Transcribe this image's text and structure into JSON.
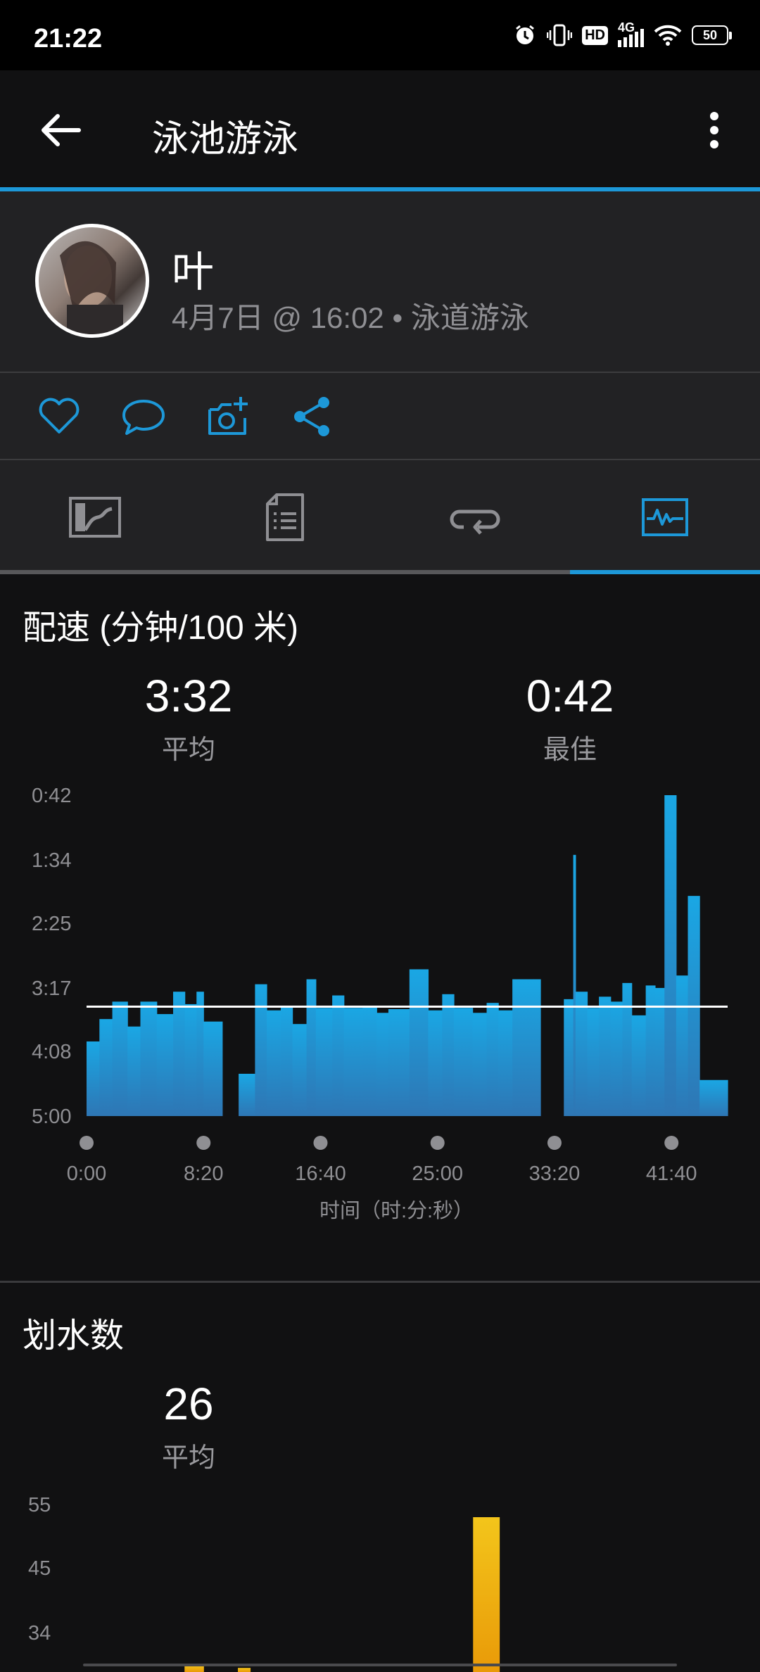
{
  "status": {
    "time": "21:22",
    "hd": "HD",
    "net": "4G",
    "battery": "50"
  },
  "appbar": {
    "title": "泳池游泳",
    "back_icon": "arrow-left-icon",
    "more_icon": "more-vert-icon"
  },
  "header": {
    "name": "叶",
    "meta": "4月7日 @ 16:02 • 泳道游泳"
  },
  "actions": [
    {
      "icon": "heart-icon"
    },
    {
      "icon": "comment-icon"
    },
    {
      "icon": "add-photo-icon"
    },
    {
      "icon": "share-icon"
    }
  ],
  "tabs": [
    {
      "icon": "map-icon",
      "active": false
    },
    {
      "icon": "details-icon",
      "active": false
    },
    {
      "icon": "laps-icon",
      "active": false
    },
    {
      "icon": "charts-icon",
      "active": true
    }
  ],
  "colors": {
    "accent": "#1d98d8",
    "pace_bar": "#2b8fcb",
    "stroke_bar": "#f0a70a",
    "background": "#111112"
  },
  "pace": {
    "title": "配速 (分钟/100 米)",
    "avg_value": "3:32",
    "avg_label": "平均",
    "best_value": "0:42",
    "best_label": "最佳",
    "xlabel": "时间（时:分:秒）"
  },
  "strokes": {
    "title": "划水数",
    "avg_value": "26",
    "avg_label": "平均"
  },
  "chart_data": [
    {
      "type": "bar",
      "title": "配速 (分钟/100 米)",
      "xlabel": "时间（时:分:秒）",
      "ylabel": "",
      "y_unit": "seconds per 100 m (axis inverted, faster at top)",
      "y_tick_labels": [
        "0:42",
        "1:34",
        "2:25",
        "3:17",
        "4:08",
        "5:00"
      ],
      "y_ticks_seconds": [
        42,
        94,
        145,
        197,
        248,
        300
      ],
      "ylim_seconds": [
        42,
        300
      ],
      "x_tick_labels": [
        "0:00",
        "8:20",
        "16:40",
        "25:00",
        "33:20",
        "41:40"
      ],
      "x_ticks_seconds": [
        0,
        500,
        1000,
        1500,
        2000,
        2500
      ],
      "xlim_seconds": [
        0,
        2740
      ],
      "average_line_seconds": 212,
      "bins": [
        [
          0,
          55,
          240
        ],
        [
          55,
          110,
          222
        ],
        [
          110,
          175,
          208
        ],
        [
          175,
          230,
          228
        ],
        [
          230,
          300,
          208
        ],
        [
          300,
          370,
          218
        ],
        [
          370,
          420,
          200
        ],
        [
          420,
          470,
          210
        ],
        [
          470,
          500,
          200
        ],
        [
          500,
          580,
          224
        ],
        [
          580,
          650,
          300
        ],
        [
          650,
          720,
          266
        ],
        [
          720,
          770,
          194
        ],
        [
          770,
          830,
          215
        ],
        [
          830,
          880,
          212
        ],
        [
          880,
          940,
          226
        ],
        [
          940,
          980,
          190
        ],
        [
          980,
          1050,
          213
        ],
        [
          1050,
          1100,
          203
        ],
        [
          1100,
          1180,
          213
        ],
        [
          1180,
          1240,
          212
        ],
        [
          1240,
          1290,
          217
        ],
        [
          1290,
          1380,
          214
        ],
        [
          1380,
          1460,
          182
        ],
        [
          1460,
          1520,
          215
        ],
        [
          1520,
          1570,
          202
        ],
        [
          1570,
          1650,
          213
        ],
        [
          1650,
          1710,
          217
        ],
        [
          1710,
          1760,
          209
        ],
        [
          1760,
          1820,
          215
        ],
        [
          1820,
          1910,
          190
        ],
        [
          1910,
          1940,
          190
        ],
        [
          2040,
          2080,
          206
        ],
        [
          2080,
          2090,
          90
        ],
        [
          2090,
          2140,
          200
        ],
        [
          2140,
          2190,
          213
        ],
        [
          2190,
          2240,
          204
        ],
        [
          2240,
          2290,
          208
        ],
        [
          2290,
          2330,
          193
        ],
        [
          2330,
          2390,
          219
        ],
        [
          2390,
          2430,
          195
        ],
        [
          2430,
          2470,
          197
        ],
        [
          2470,
          2520,
          42
        ],
        [
          2520,
          2570,
          187
        ],
        [
          2570,
          2620,
          123
        ],
        [
          2620,
          2740,
          271
        ]
      ]
    },
    {
      "type": "bar",
      "title": "划水数",
      "xlabel": "",
      "ylabel": "",
      "y_tick_labels": [
        "55",
        "45",
        "34"
      ],
      "ylim": [
        26,
        55
      ],
      "average": 26,
      "bins": [
        [
          0,
          60,
          27
        ],
        [
          500,
          580,
          28.5
        ],
        [
          720,
          770,
          28
        ],
        [
          800,
          860,
          27
        ],
        [
          1040,
          1090,
          27
        ],
        [
          1140,
          1200,
          27
        ],
        [
          1280,
          1340,
          27
        ],
        [
          1470,
          1520,
          27
        ],
        [
          1690,
          1800,
          53
        ],
        [
          2100,
          2160,
          27
        ],
        [
          2330,
          2390,
          27
        ],
        [
          2600,
          2660,
          27
        ]
      ]
    }
  ]
}
